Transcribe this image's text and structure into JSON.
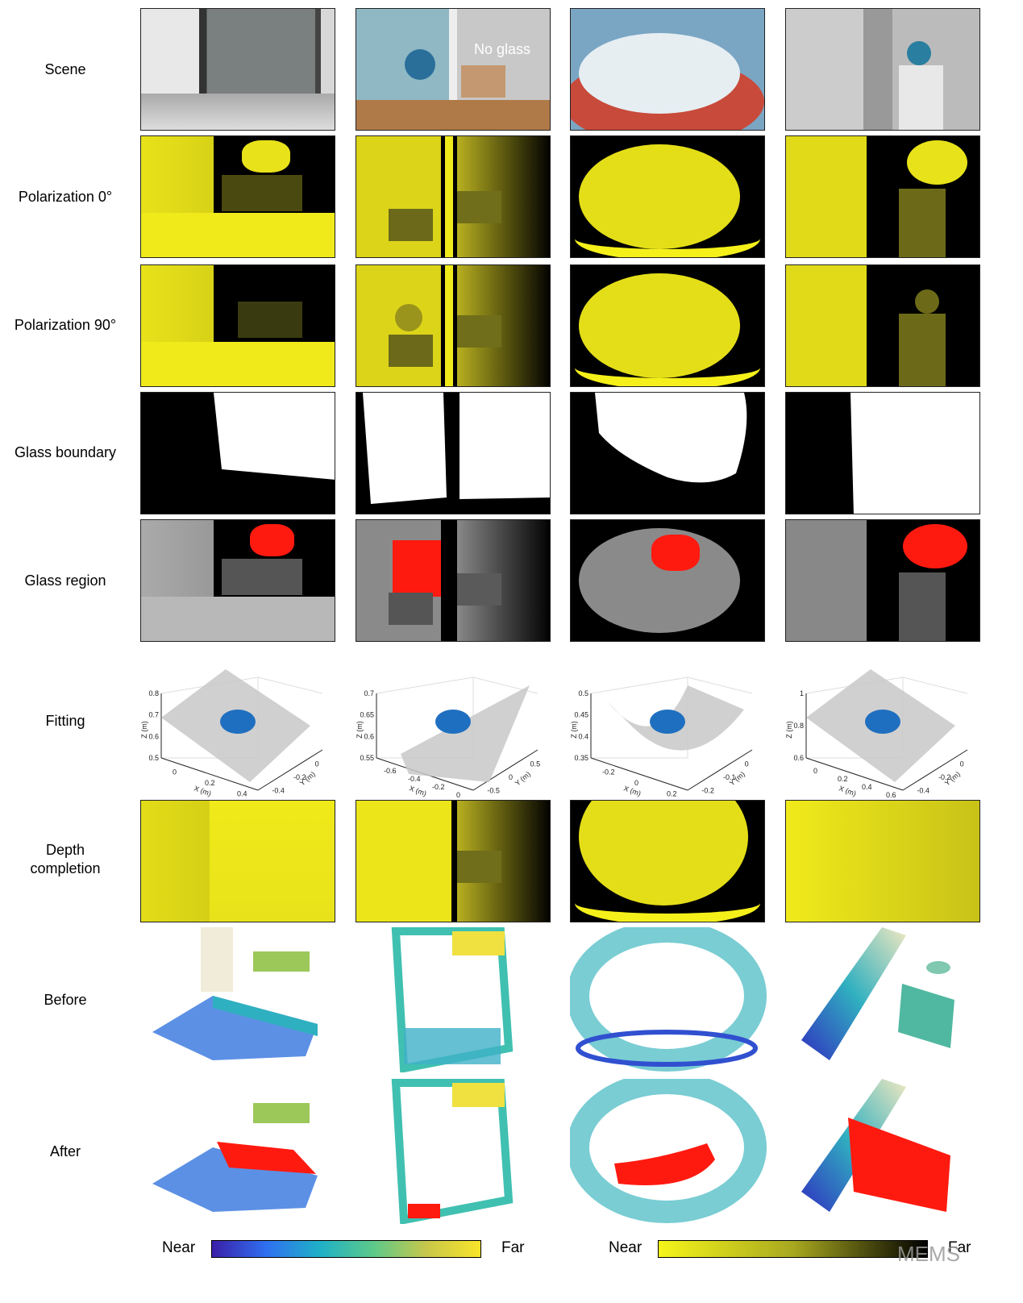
{
  "row_labels": {
    "scene": "Scene",
    "pol0": "Polarization 0°",
    "pol90": "Polarization 90°",
    "boundary": "Glass boundary",
    "region": "Glass region",
    "fitting": "Fitting",
    "completion_1": "Depth",
    "completion_2": "completion",
    "before": "Before",
    "after": "After"
  },
  "scene_annotation": "No glass",
  "fitting_plots": [
    {
      "zlabel": "Z (m)",
      "xlabel": "X (m)",
      "ylabel": "Y (m)",
      "z_ticks": [
        "0.8",
        "0.7",
        "0.6",
        "0.5"
      ],
      "x_ticks": [
        "0",
        "0.2",
        "0.4"
      ],
      "y_ticks": [
        "-0.4",
        "-0.2",
        "0"
      ],
      "surface": "plane"
    },
    {
      "zlabel": "Z (m)",
      "xlabel": "X (m)",
      "ylabel": "Y (m)",
      "z_ticks": [
        "0.7",
        "0.65",
        "0.6",
        "0.55"
      ],
      "x_ticks": [
        "-0.6",
        "-0.4",
        "-0.2",
        "0"
      ],
      "y_ticks": [
        "-0.5",
        "0",
        "0.5"
      ],
      "surface": "plane"
    },
    {
      "zlabel": "Z (m)",
      "xlabel": "X (m)",
      "ylabel": "Y (m)",
      "z_ticks": [
        "0.5",
        "0.45",
        "0.4",
        "0.35"
      ],
      "x_ticks": [
        "-0.2",
        "0",
        "0.2"
      ],
      "y_ticks": [
        "-0.2",
        "-0.1",
        "0"
      ],
      "surface": "paraboloid"
    },
    {
      "zlabel": "Z (m)",
      "xlabel": "X (m)",
      "ylabel": "Y (m)",
      "z_ticks": [
        "1",
        "0.8",
        "0.6"
      ],
      "x_ticks": [
        "0",
        "0.2",
        "0.4",
        "0.6"
      ],
      "y_ticks": [
        "-0.4",
        "-0.2",
        "0"
      ],
      "surface": "plane"
    }
  ],
  "colorbars": [
    {
      "near": "Near",
      "far": "Far",
      "colors": [
        "#3b1fa8",
        "#2f6ff0",
        "#1fb0c8",
        "#5cc98a",
        "#c8c74a",
        "#f8e52a"
      ]
    },
    {
      "near": "Near",
      "far": "Far",
      "colors": [
        "#f5f51a",
        "#a8a820",
        "#000000"
      ]
    }
  ],
  "watermark": "MEMS",
  "colors": {
    "depth_yellow": "#f0ea1a",
    "glass_red": "#ff1a10",
    "fit_points": "#1f6fc0",
    "fit_surface": "#c8c8c8"
  }
}
